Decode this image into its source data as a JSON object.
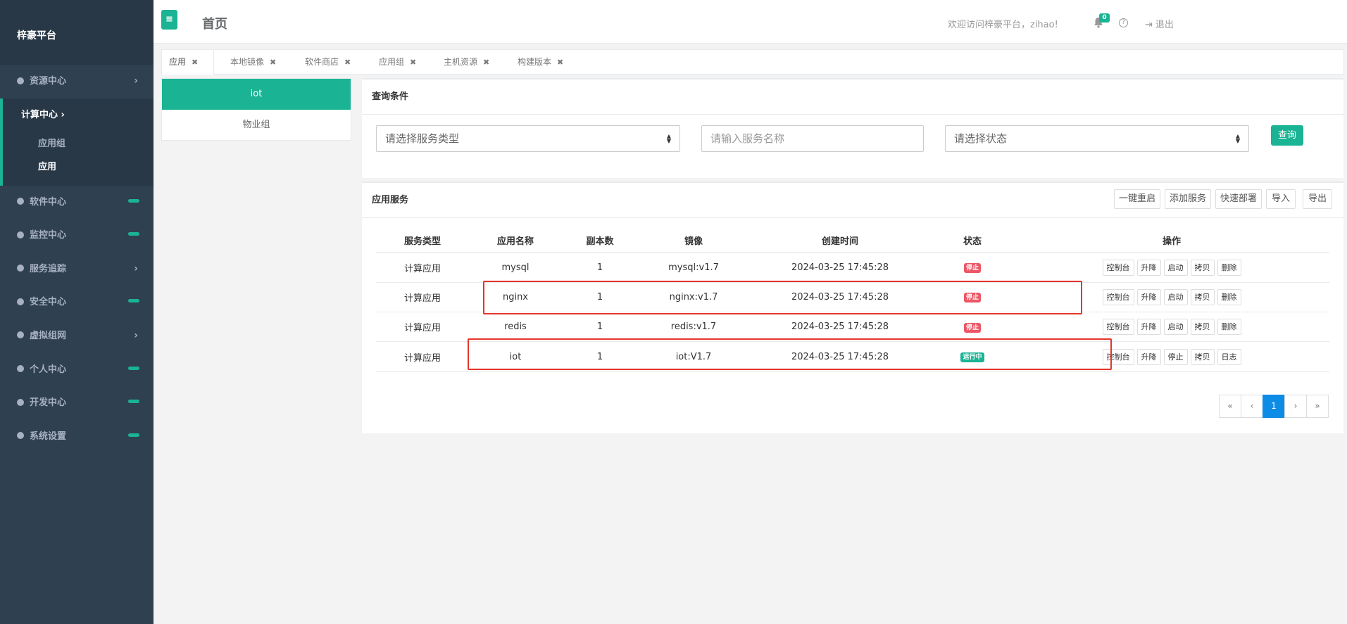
{
  "sidebar": {
    "brand": "梓豪平台",
    "items": [
      {
        "label": "资源中心",
        "marker": "arrow"
      },
      {
        "label": "计算中心",
        "marker": "arrow"
      },
      {
        "label": "软件中心",
        "marker": "pill"
      },
      {
        "label": "监控中心",
        "marker": "pill"
      },
      {
        "label": "服务追踪",
        "marker": "arrow"
      },
      {
        "label": "安全中心",
        "marker": "pill"
      },
      {
        "label": "虚拟组网",
        "marker": "arrow"
      },
      {
        "label": "个人中心",
        "marker": "pill"
      },
      {
        "label": "开发中心",
        "marker": "pill"
      },
      {
        "label": "系统设置",
        "marker": "pill"
      }
    ],
    "sub_items": [
      "应用组",
      "应用"
    ],
    "active_sub": "应用"
  },
  "header": {
    "menu_icon": "≡",
    "title": "首页",
    "welcome": "欢迎访问梓豪平台，zihao!",
    "notification_count": "0",
    "help": "?",
    "logout": "退出"
  },
  "tabs": [
    {
      "label": "应用",
      "close": "✖"
    },
    {
      "label": "本地镜像",
      "close": "✖"
    },
    {
      "label": "软件商店",
      "close": "✖"
    },
    {
      "label": "应用组",
      "close": "✖"
    },
    {
      "label": "主机资源",
      "close": "✖"
    },
    {
      "label": "构建版本",
      "close": "✖"
    }
  ],
  "groups": {
    "items": [
      "iot",
      "物业组"
    ],
    "active": "iot"
  },
  "query": {
    "title": "查询条件",
    "service_type_placeholder": "请选择服务类型",
    "service_name_placeholder": "请输入服务名称",
    "status_placeholder": "请选择状态",
    "submit": "查询"
  },
  "services": {
    "title": "应用服务",
    "toolbar": [
      "一键重启",
      "添加服务",
      "快速部署",
      "导入",
      "导出"
    ],
    "columns": [
      "服务类型",
      "应用名称",
      "副本数",
      "镜像",
      "创建时间",
      "状态",
      "操作"
    ],
    "rows": [
      {
        "type": "计算应用",
        "name": "mysql",
        "replicas": "1",
        "image": "mysql:v1.7",
        "created": "2024-03-25 17:45:28",
        "status": "停止",
        "ops": [
          "控制台",
          "升降",
          "启动",
          "拷贝",
          "删除"
        ]
      },
      {
        "type": "计算应用",
        "name": "nginx",
        "replicas": "1",
        "image": "nginx:v1.7",
        "created": "2024-03-25 17:45:28",
        "status": "停止",
        "ops": [
          "控制台",
          "升降",
          "启动",
          "拷贝",
          "删除"
        ]
      },
      {
        "type": "计算应用",
        "name": "redis",
        "replicas": "1",
        "image": "redis:v1.7",
        "created": "2024-03-25 17:45:28",
        "status": "停止",
        "ops": [
          "控制台",
          "升降",
          "启动",
          "拷贝",
          "删除"
        ]
      },
      {
        "type": "计算应用",
        "name": "iot",
        "replicas": "1",
        "image": "iot:V1.7",
        "created": "2024-03-25 17:45:28",
        "status": "运行中",
        "ops": [
          "控制台",
          "升降",
          "停止",
          "拷贝",
          "日志"
        ]
      }
    ],
    "pagination": [
      "«",
      "‹",
      "1",
      "›",
      "»"
    ],
    "current_page": "1"
  },
  "colors": {
    "accent": "#1ab394",
    "sidebar": "#2f4050",
    "stop": "#ed5565",
    "running": "#1ab394",
    "highlight": "#e5342b"
  }
}
